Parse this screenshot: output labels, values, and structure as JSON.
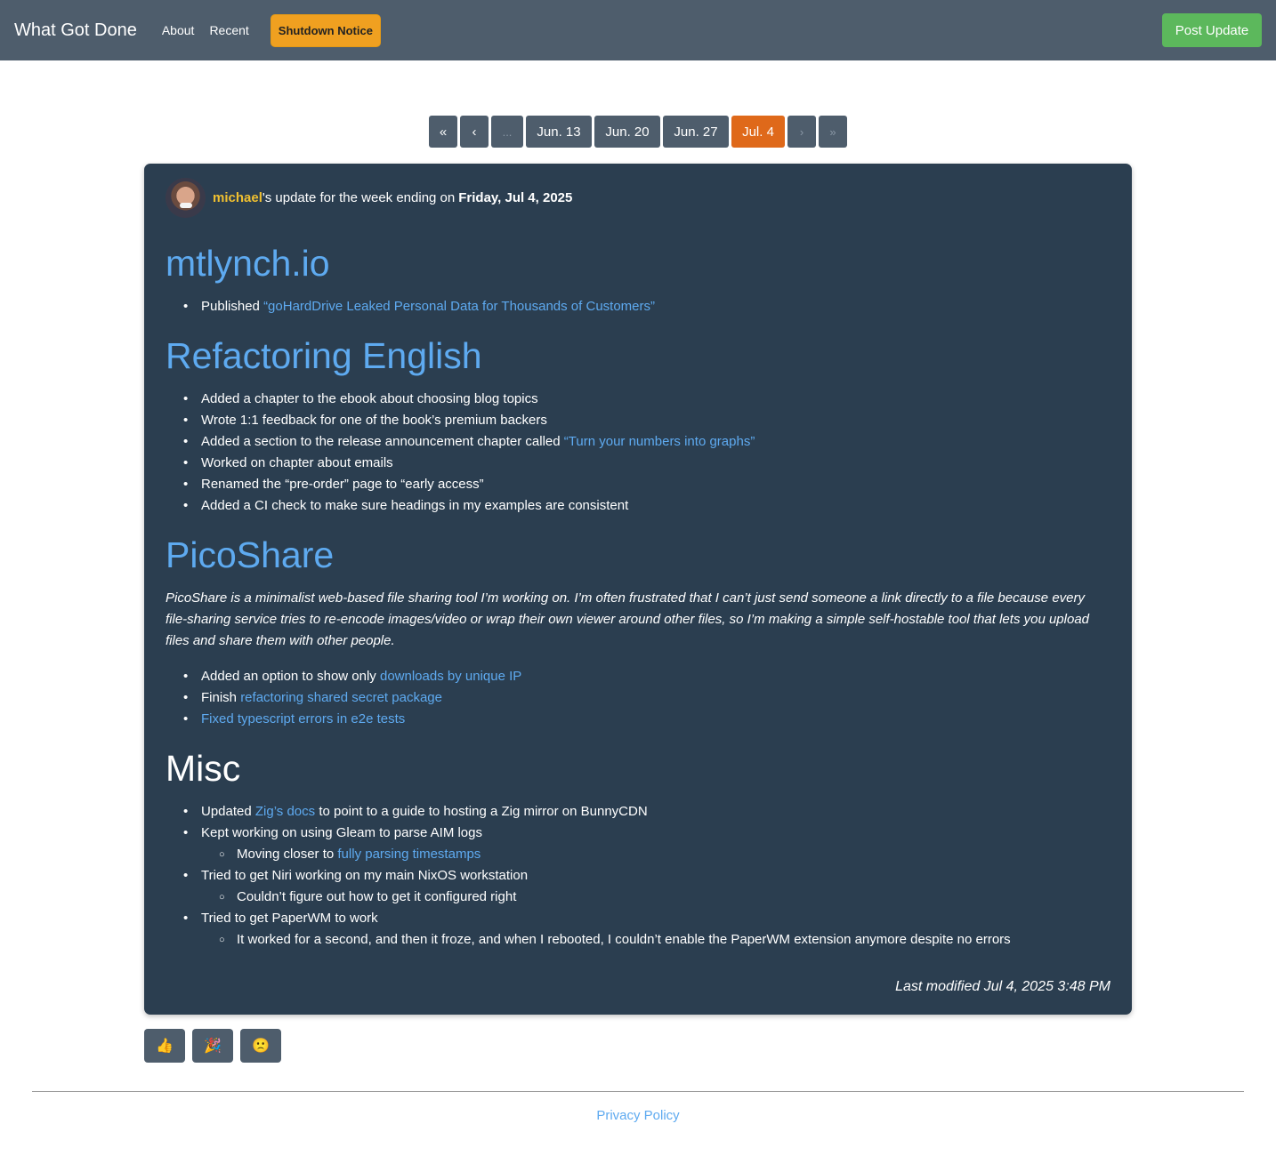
{
  "nav": {
    "brand": "What Got Done",
    "links": [
      "About",
      "Recent"
    ],
    "shutdown": "Shutdown Notice",
    "post": "Post Update"
  },
  "pager": {
    "first": "«",
    "prev": "‹",
    "ellipsis": "...",
    "weeks": [
      "Jun. 13",
      "Jun. 20",
      "Jun. 27"
    ],
    "current": "Jul. 4",
    "next": "›",
    "last": "»"
  },
  "post": {
    "username": "michael",
    "byline_mid": "'s update for the week ending on",
    "date": "Friday, Jul 4, 2025",
    "sections": [
      {
        "title": "mtlynch.io",
        "items": [
          {
            "pre": "Published ",
            "link": "“goHardDrive Leaked Personal Data for Thousands of Customers”",
            "post": ""
          }
        ]
      },
      {
        "title": "Refactoring English",
        "items": [
          {
            "pre": "Added a chapter to the ebook about choosing blog topics"
          },
          {
            "pre": "Wrote 1:1 feedback for one of the book’s premium backers"
          },
          {
            "pre": "Added a section to the release announcement chapter called ",
            "link": "“Turn your numbers into graphs”"
          },
          {
            "pre": "Worked on chapter about emails"
          },
          {
            "pre": "Renamed the “pre-order” page to “early access”"
          },
          {
            "pre": "Added a CI check to make sure headings in my examples are consistent"
          }
        ]
      },
      {
        "title": "PicoShare",
        "intro": "PicoShare is a minimalist web-based file sharing tool I’m working on. I’m often frustrated that I can’t just send someone a link directly to a file because every file-sharing service tries to re-encode images/video or wrap their own viewer around other files, so I’m making a simple self-hostable tool that lets you upload files and share them with other people.",
        "items": [
          {
            "pre": "Added an option to show only ",
            "link": "downloads by unique IP"
          },
          {
            "pre": "Finish ",
            "link": "refactoring shared secret package"
          },
          {
            "pre": "",
            "link": "Fixed typescript errors in e2e tests"
          }
        ]
      },
      {
        "title": "Misc",
        "items": [
          {
            "pre": "Updated ",
            "link": "Zig’s docs",
            "post": " to point to a guide to hosting a Zig mirror on BunnyCDN"
          },
          {
            "pre": "Kept working on using Gleam to parse AIM logs"
          },
          {
            "pre": "Moving closer to ",
            "link": "fully parsing timestamps",
            "sub": true
          },
          {
            "pre": "Tried to get Niri working on my main NixOS workstation"
          },
          {
            "pre": "Couldn’t figure out how to get it configured right",
            "sub": true
          },
          {
            "pre": "Tried to get PaperWM to work"
          },
          {
            "pre": "It worked for a second, and then it froze, and when I rebooted, I couldn’t enable the PaperWM extension anymore despite no errors",
            "sub": true
          }
        ]
      }
    ],
    "modified": "Last modified Jul 4, 2025 3:48 PM"
  },
  "reactions": [
    "👍",
    "🎉",
    "🙁"
  ],
  "footer": {
    "privacy": "Privacy Policy"
  }
}
